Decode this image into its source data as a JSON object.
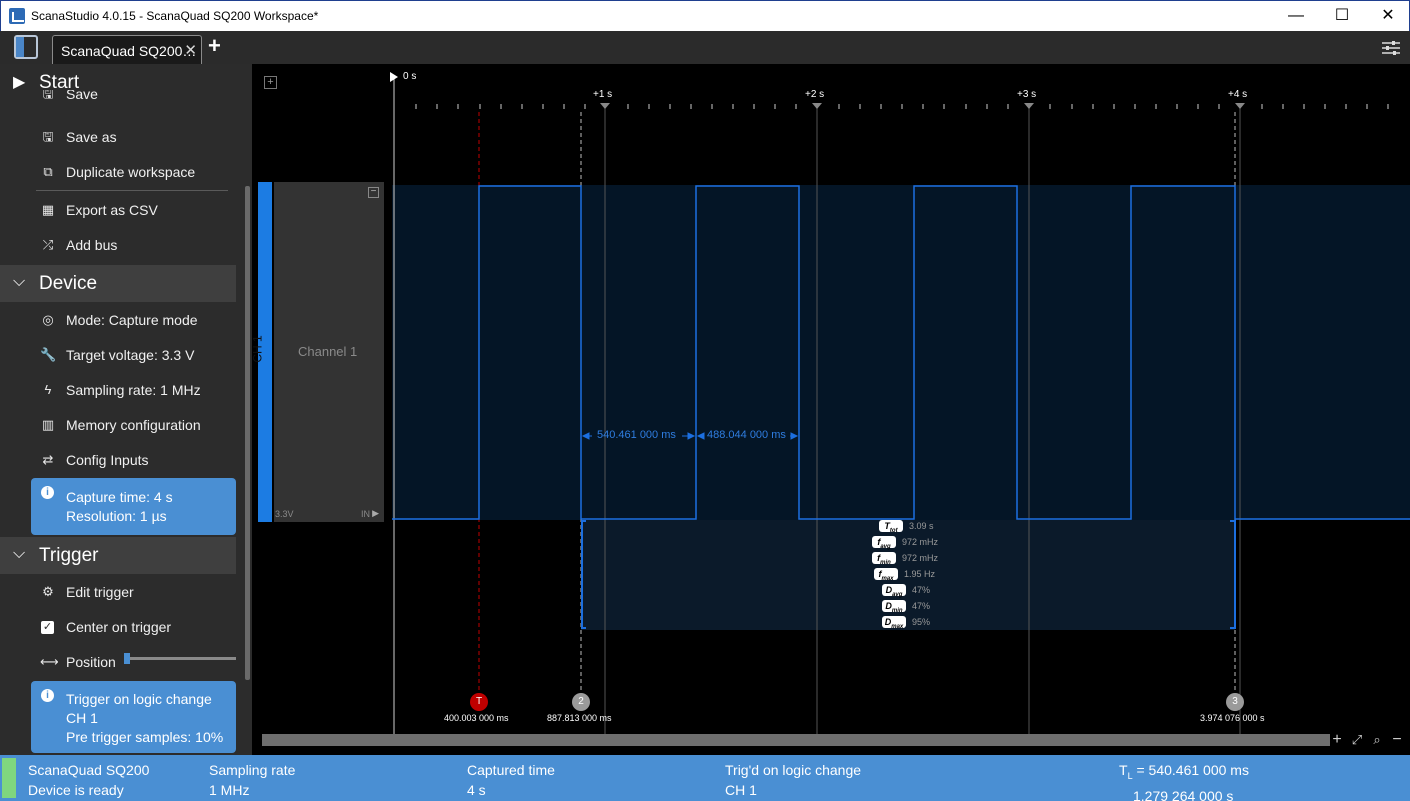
{
  "window": {
    "title": "ScanaStudio 4.0.15 - ScanaQuad SQ200 Workspace*",
    "minimize": "—",
    "maximize": "☐",
    "close": "✕"
  },
  "tabs": {
    "active_label": "ScanaQuad SQ200…",
    "close_glyph": "✕",
    "add_glyph": "+"
  },
  "sidebar": {
    "start": {
      "label": "Start",
      "chevron": "▶"
    },
    "file_items": [
      {
        "label": "Save",
        "icon": "save-icon"
      },
      {
        "label": "Save as",
        "icon": "save-as-icon"
      },
      {
        "label": "Duplicate workspace",
        "icon": "duplicate-icon"
      },
      {
        "label": "Export as CSV",
        "icon": "table-icon"
      },
      {
        "label": "Add bus",
        "icon": "shuffle-icon"
      }
    ],
    "device": {
      "label": "Device",
      "chevron": "⌵",
      "items": [
        {
          "label": "Mode: Capture mode",
          "icon": "mode-icon"
        },
        {
          "label": "Target voltage: 3.3 V",
          "icon": "wrench-icon"
        },
        {
          "label": "Sampling rate: 1 MHz",
          "icon": "bolt-icon"
        },
        {
          "label": "Memory configuration",
          "icon": "chip-icon"
        },
        {
          "label": "Config Inputs",
          "icon": "swap-icon"
        }
      ],
      "info": [
        "Capture time: 4 s",
        "Resolution: 1 µs"
      ]
    },
    "trigger": {
      "label": "Trigger",
      "chevron": "⌵",
      "items": [
        {
          "label": "Edit trigger",
          "icon": "gear-icon"
        },
        {
          "label": "Center on trigger",
          "icon": "checkbox-icon"
        },
        {
          "label": "Position",
          "icon": "arrows-h-icon"
        }
      ],
      "info": [
        "Trigger on logic change",
        "CH 1",
        "Pre trigger samples: 10%"
      ]
    }
  },
  "timeline": {
    "ticks": [
      "0 s",
      "+1 s",
      "+2 s",
      "+3 s",
      "+4 s"
    ]
  },
  "channel": {
    "tag": "CH 1",
    "name": "Channel 1",
    "voltage": "3.3V",
    "input": "IN"
  },
  "measurements": {
    "pulse_high": "540.461 000 ms",
    "pulse_low": "488.044 000 ms"
  },
  "stats": [
    {
      "key": "T",
      "sub": "tot",
      "value": "3.09 s"
    },
    {
      "key": "f",
      "sub": "avg",
      "value": "972 mHz"
    },
    {
      "key": "f",
      "sub": "min",
      "value": "972 mHz"
    },
    {
      "key": "f",
      "sub": "max",
      "value": "1.95 Hz"
    },
    {
      "key": "D",
      "sub": "avg",
      "value": "47%"
    },
    {
      "key": "D",
      "sub": "min",
      "value": "47%"
    },
    {
      "key": "D",
      "sub": "max",
      "value": "95%"
    }
  ],
  "markers": [
    {
      "id": "T",
      "time": "400.003 000 ms",
      "color": "#c00000"
    },
    {
      "id": "2",
      "time": "887.813 000 ms",
      "color": "#9a9a9a"
    },
    {
      "id": "3",
      "time": "3.974 076 000 s",
      "color": "#9a9a9a"
    }
  ],
  "statusbar": {
    "device_name": "ScanaQuad SQ200",
    "device_state": "Device is ready",
    "sampling_label": "Sampling rate",
    "sampling_value": "1 MHz",
    "captured_label": "Captured time",
    "captured_value": "4 s",
    "trig_label": "Trig'd on logic change",
    "trig_value": "CH 1",
    "tl_label": "T",
    "tl_sub": "L",
    "tl_value": " = 540.461 000 ms",
    "tl_extra": "1.279 264 000 s"
  },
  "colors": {
    "accent": "#4a8fd3",
    "signal": "#1c6fe0",
    "trigger_marker": "#c00000"
  }
}
